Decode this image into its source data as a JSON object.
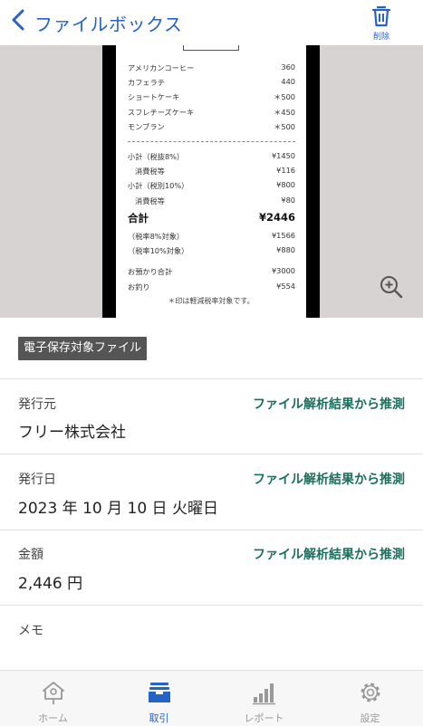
{
  "header": {
    "title": "ファイルボックス",
    "delete_label": "削除"
  },
  "receipt": {
    "items": [
      {
        "name": "アメリカンコーヒー",
        "price": "360"
      },
      {
        "name": "カフェラテ",
        "price": "440"
      },
      {
        "name": "ショートケーキ",
        "price": "＊500"
      },
      {
        "name": "スフレチーズケーキ",
        "price": "＊450"
      },
      {
        "name": "モンブラン",
        "price": "＊500"
      }
    ],
    "summary": [
      {
        "name": "小計（税抜8%）",
        "value": "¥1450"
      },
      {
        "name": "消費税等",
        "value": "¥116"
      },
      {
        "name": "小計（税別10%）",
        "value": "¥800"
      },
      {
        "name": "消費税等",
        "value": "¥80"
      }
    ],
    "total": {
      "name": "合計",
      "value": "¥2446"
    },
    "tax_breakdown": [
      {
        "name": "（税率8%対象）",
        "value": "¥1566"
      },
      {
        "name": "（税率10%対象）",
        "value": "¥880"
      }
    ],
    "payment": [
      {
        "name": "お預かり合計",
        "value": "¥3000"
      },
      {
        "name": "お釣り",
        "value": "¥554"
      }
    ],
    "note": "＊印は軽減税率対象です。"
  },
  "tag": "電子保存対象ファイル",
  "fields": {
    "issuer": {
      "label": "発行元",
      "hint": "ファイル解析結果から推測",
      "value": "フリー株式会社"
    },
    "date": {
      "label": "発行日",
      "hint": "ファイル解析結果から推測",
      "value": "2023 年 10 月 10 日 火曜日"
    },
    "amount": {
      "label": "金額",
      "hint": "ファイル解析結果から推測",
      "value": "2,446 円"
    },
    "memo": {
      "label": "メモ"
    }
  },
  "tabs": [
    {
      "label": "ホーム",
      "icon": "home-icon"
    },
    {
      "label": "取引",
      "icon": "inbox-icon"
    },
    {
      "label": "レポート",
      "icon": "bar-chart-icon"
    },
    {
      "label": "設定",
      "icon": "gear-icon"
    }
  ],
  "colors": {
    "accent": "#2563c7",
    "hint": "#1a6f5e",
    "tag_bg": "#555555"
  }
}
